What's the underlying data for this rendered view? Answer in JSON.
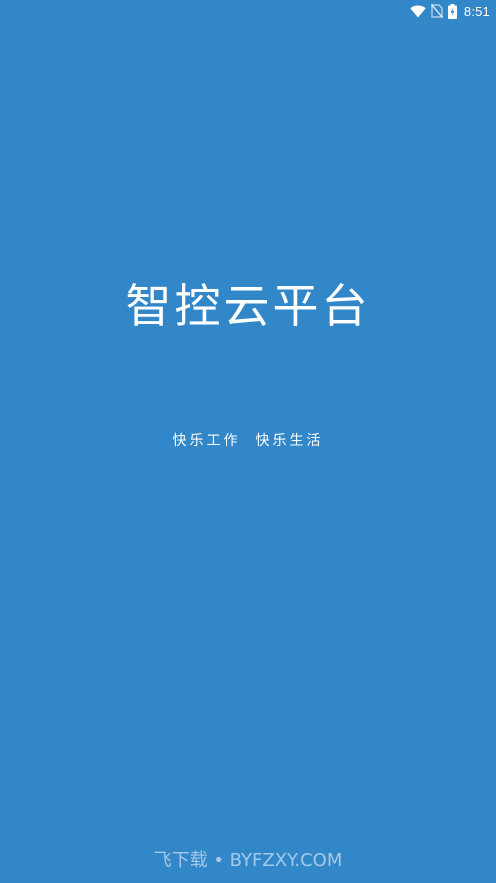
{
  "status_bar": {
    "time": "8:51",
    "icons": [
      "wifi-icon",
      "no-sim-icon",
      "battery-charging-icon"
    ]
  },
  "splash": {
    "title": "智控云平台",
    "slogan": "快乐工作  快乐生活"
  },
  "watermark": {
    "text": "飞下载 • BYFZXY.COM"
  },
  "colors": {
    "background": "#3287c9",
    "text": "#ffffff"
  }
}
